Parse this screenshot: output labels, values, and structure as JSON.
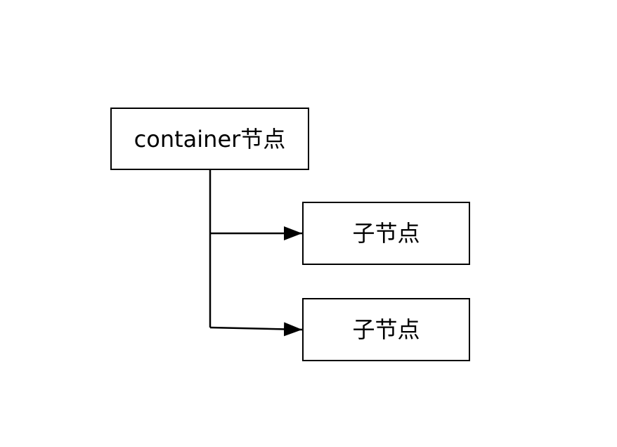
{
  "diagram": {
    "nodes": {
      "container": {
        "label": "container节点"
      },
      "child_1": {
        "label": "子节点"
      },
      "child_2": {
        "label": "子节点"
      }
    },
    "edges": [
      {
        "from": "container",
        "to": "child_1"
      },
      {
        "from": "container",
        "to": "child_2"
      }
    ]
  }
}
